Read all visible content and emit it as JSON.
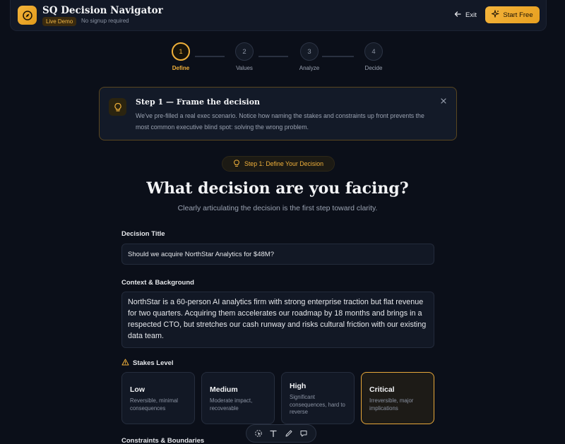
{
  "header": {
    "app_title": "SQ Decision Navigator",
    "badge": "Live Demo",
    "subtitle": "No signup required",
    "exit_label": "Exit",
    "start_label": "Start Free",
    "accent": "#f0b03a"
  },
  "stepper": {
    "current": 1,
    "steps": [
      {
        "number": "1",
        "label": "Define"
      },
      {
        "number": "2",
        "label": "Values"
      },
      {
        "number": "3",
        "label": "Analyze"
      },
      {
        "number": "4",
        "label": "Decide"
      }
    ]
  },
  "tip": {
    "title": "Step 1 — Frame the decision",
    "body": "We've pre-filled a real exec scenario. Notice how naming the stakes and constraints up front prevents the most common executive blind spot: solving the wrong problem."
  },
  "main": {
    "pill": "Step 1: Define Your Decision",
    "heading": "What decision are you facing?",
    "subheading": "Clearly articulating the decision is the first step toward clarity."
  },
  "form": {
    "title_label": "Decision Title",
    "title_value": "Should we acquire NorthStar Analytics for $48M?",
    "context_label": "Context & Background",
    "context_value": "NorthStar is a 60-person AI analytics firm with strong enterprise traction but flat revenue for two quarters. Acquiring them accelerates our roadmap by 18 months and brings in a respected CTO, but stretches our cash runway and risks cultural friction with our existing data team.",
    "stakes_label": "Stakes Level",
    "stakes": [
      {
        "title": "Low",
        "desc": "Reversible, minimal consequences",
        "selected": false
      },
      {
        "title": "Medium",
        "desc": "Moderate impact, recoverable",
        "selected": false
      },
      {
        "title": "High",
        "desc": "Significant consequences, hard to reverse",
        "selected": false
      },
      {
        "title": "Critical",
        "desc": "Irreversible, major implications",
        "selected": true
      }
    ],
    "constraints_label": "Constraints & Boundaries"
  },
  "toolbar": {
    "icons": [
      "select-icon",
      "text-icon",
      "pen-icon",
      "comment-icon"
    ]
  }
}
